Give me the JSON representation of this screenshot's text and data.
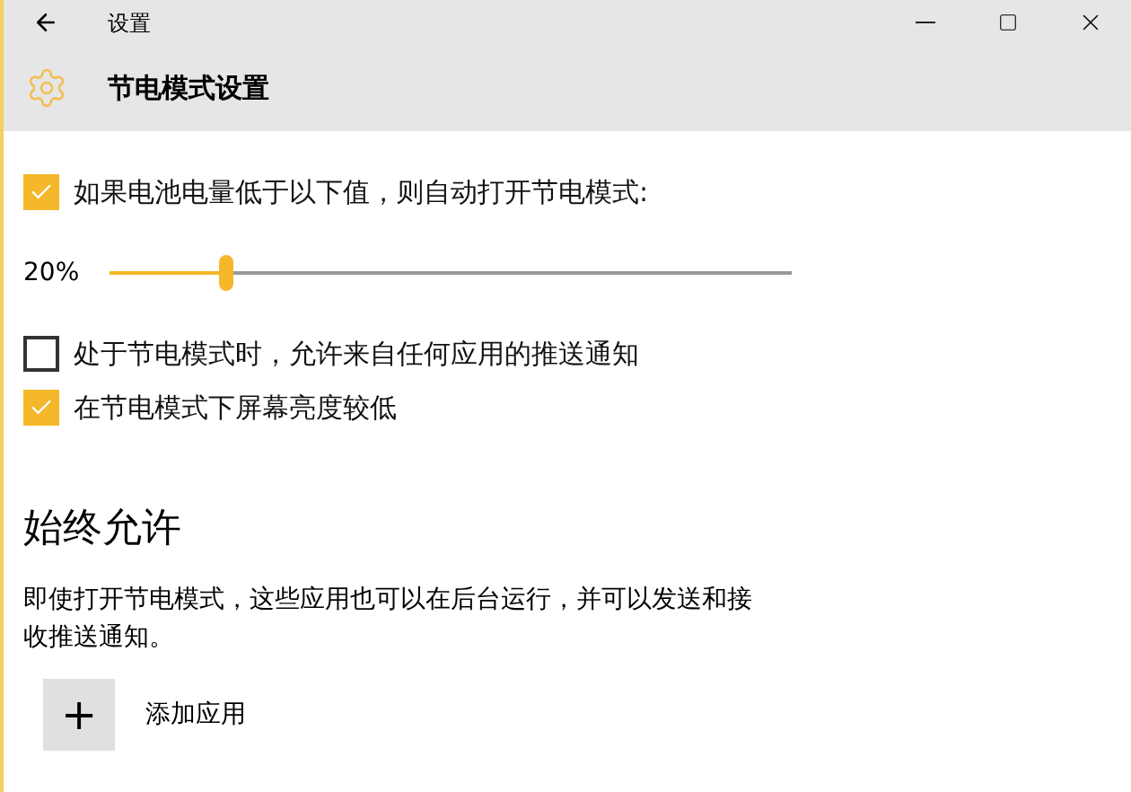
{
  "window": {
    "title": "设置"
  },
  "page": {
    "title": "节电模式设置"
  },
  "options": [
    {
      "kind": "checkbox",
      "label": "如果电池电量低于以下值，则自动打开节电模式:",
      "checked": true
    },
    {
      "kind": "slider",
      "reading": "20%",
      "level": 0.17
    },
    {
      "kind": "checkbox",
      "label": "处于节电模式时，允许来自任何应用的推送通知",
      "checked": false
    },
    {
      "kind": "checkbox",
      "label": "在节电模式下屏幕亮度较低",
      "checked": true
    }
  ],
  "always_allow": {
    "heading": "始终允许",
    "description": "即使打开节电模式，这些应用也可以在后台运行，并可以发送和接收推送通知。",
    "add_button": {
      "icon": "+",
      "label": "添加应用"
    }
  }
}
